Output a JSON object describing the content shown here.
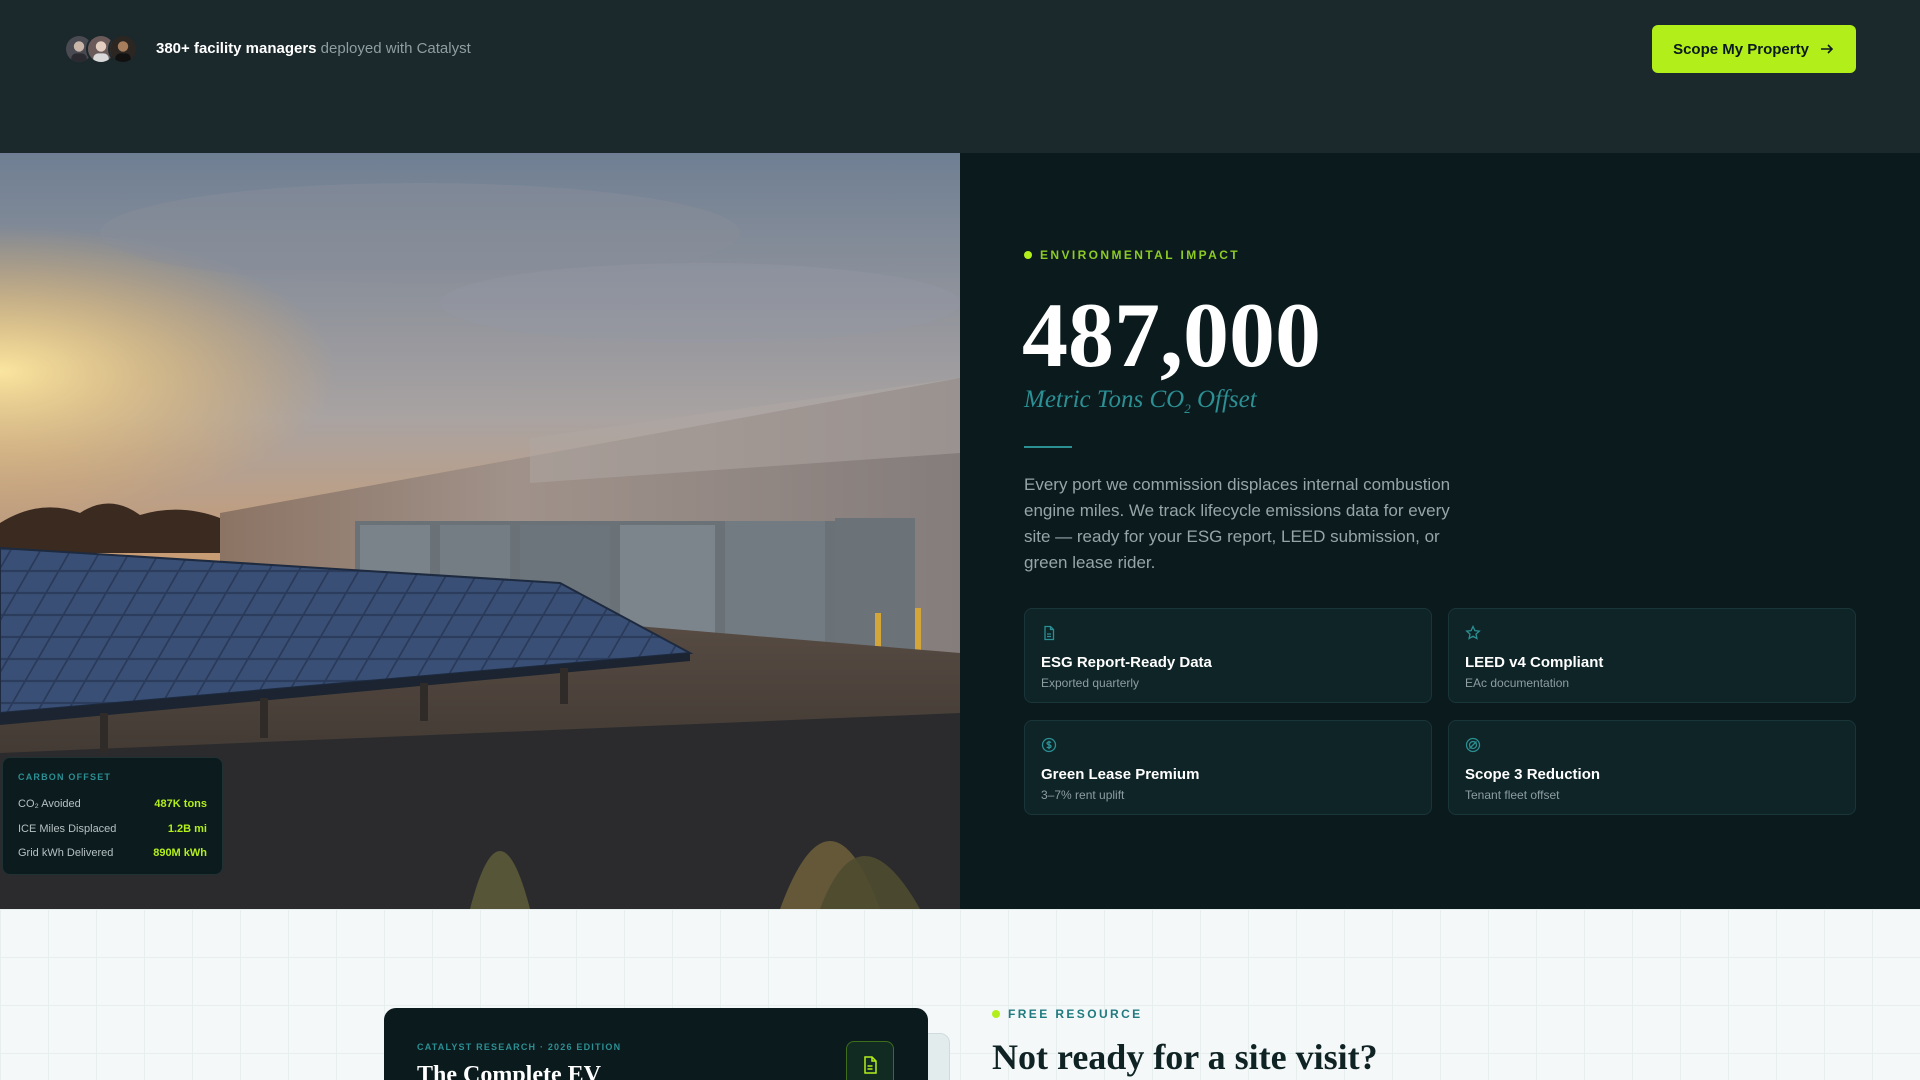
{
  "header": {
    "proof_bold": "380+ facility managers",
    "proof_rest": " deployed with Catalyst",
    "cta_label": "Scope My Property",
    "avatars": [
      "avatar-1",
      "avatar-2",
      "avatar-3"
    ]
  },
  "carbon_offset": {
    "label": "CARBON OFFSET",
    "rows": [
      {
        "label": "CO₂ Avoided",
        "value": "487K tons"
      },
      {
        "label": "ICE Miles Displaced",
        "value": "1.2B mi"
      },
      {
        "label": "Grid kWh Delivered",
        "value": "890M kWh"
      }
    ]
  },
  "impact": {
    "eyebrow": "ENVIRONMENTAL IMPACT",
    "number": "487,000",
    "subtitle_main": "Metric Tons CO",
    "subtitle_sub": "2",
    "subtitle_end": " Offset",
    "description": "Every port we commission displaces internal combustion engine miles. We track lifecycle emissions data for every site — ready for your ESG report, LEED submission, or green lease rider.",
    "features": [
      {
        "icon": "document-icon",
        "title": "ESG Report-Ready Data",
        "sub": "Exported quarterly"
      },
      {
        "icon": "star-icon",
        "title": "LEED v4 Compliant",
        "sub": "EAc documentation"
      },
      {
        "icon": "dollar-icon",
        "title": "Green Lease Premium",
        "sub": "3–7% rent uplift"
      },
      {
        "icon": "target-icon",
        "title": "Scope 3 Reduction",
        "sub": "Tenant fleet offset"
      }
    ]
  },
  "resource": {
    "doc_meta": "CATALYST RESEARCH · 2026 EDITION",
    "doc_title": "The Complete EV",
    "eyebrow": "FREE RESOURCE",
    "title": "Not ready for a site visit?"
  },
  "colors": {
    "accent": "#b2ef1a",
    "teal": "#2b8f93",
    "dark": "#0b1a1d"
  }
}
